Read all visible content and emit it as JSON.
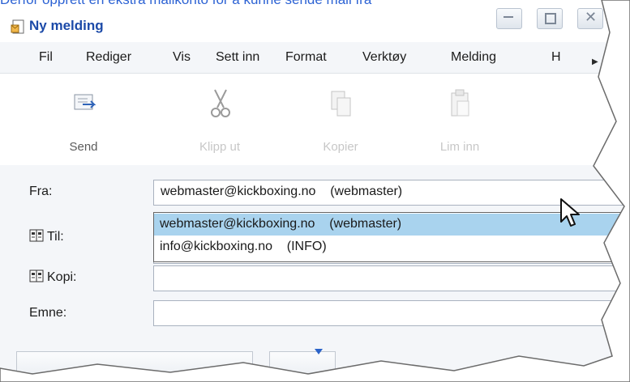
{
  "clipped_top_text": "Derfor opprett en ekstra mailkonto for å kunne sende mail fra",
  "window": {
    "title": "Ny melding"
  },
  "menubar": {
    "items": [
      "Fil",
      "Rediger",
      "Vis",
      "Sett inn",
      "Format",
      "Verktøy",
      "Melding",
      "H"
    ]
  },
  "toolbar": {
    "send": "Send",
    "cut": "Klipp ut",
    "copy": "Kopier",
    "paste": "Lim inn"
  },
  "form": {
    "from_label": "Fra:",
    "to_label": "Til:",
    "cc_label": "Kopi:",
    "subject_label": "Emne:",
    "from_value": "webmaster@kickboxing.no    (webmaster)",
    "to_value": "",
    "cc_value": "",
    "subject_value": ""
  },
  "dropdown": {
    "options": [
      "webmaster@kickboxing.no    (webmaster)",
      "info@kickboxing.no    (INFO)"
    ],
    "selected_index": 0
  },
  "colors": {
    "title_blue": "#1c4aa8",
    "selection": "#a9d3ee",
    "disabled_text": "#c7c7c7"
  }
}
